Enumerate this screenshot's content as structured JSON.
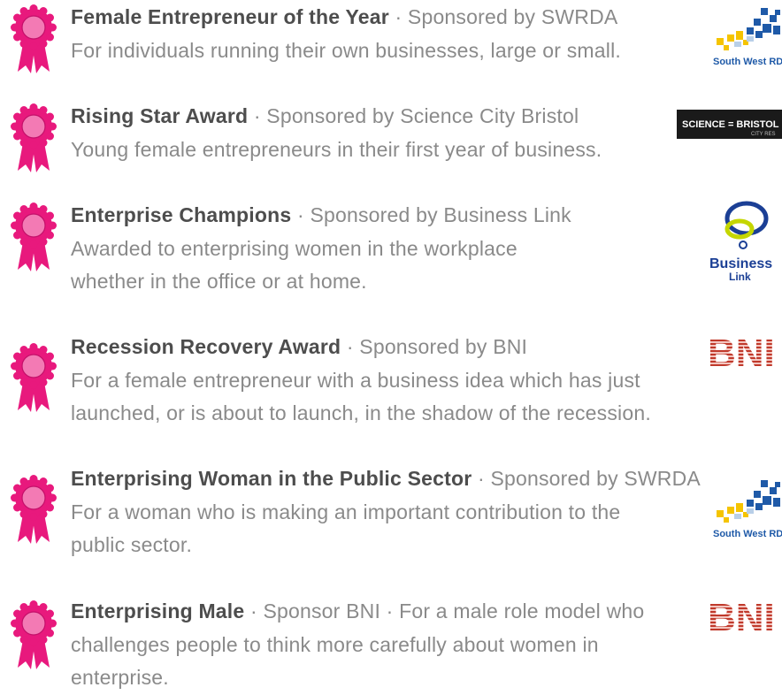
{
  "awards": [
    {
      "title": "Female Entrepreneur of the Year",
      "sponsor": "Sponsored by SWRDA",
      "desc": [
        "For individuals running their own businesses, large or small."
      ],
      "logo": "swrda",
      "logo_text": "South West RDA"
    },
    {
      "title": "Rising Star Award",
      "sponsor": "Sponsored by Science City Bristol",
      "desc": [
        "Young female entrepreneurs in their first year of business."
      ],
      "logo": "science-city",
      "logo_text": "SCIENCE = BRISTOL",
      "logo_subtext": "CITY RES"
    },
    {
      "title": "Enterprise Champions",
      "sponsor": "Sponsored by Business Link",
      "desc": [
        "Awarded to enterprising women in the workplace",
        "whether in the office or at home."
      ],
      "logo": "business-link",
      "logo_text": "Business",
      "logo_subtext": "Link"
    },
    {
      "title": "Recession Recovery Award",
      "sponsor": "Sponsored by BNI",
      "desc": [
        "For a female entrepreneur with a business idea which has just",
        "launched, or is about to launch, in the shadow of the recession."
      ],
      "logo": "bni",
      "logo_text": "BNI"
    },
    {
      "title": "Enterprising Woman in the Public Sector",
      "sponsor": "Sponsored by SWRDA",
      "desc": [
        "For a woman who is making an important contribution to the",
        "public sector."
      ],
      "logo": "swrda",
      "logo_text": "South West RDA"
    },
    {
      "title": "Enterprising Male",
      "sponsor": "Sponsor BNI · For a male role model who",
      "desc": [
        "challenges people to think more carefully about women in",
        "enterprise."
      ],
      "logo": "bni",
      "logo_text": "BNI"
    }
  ],
  "separator": " · ",
  "colors": {
    "rosette": "#e8197d",
    "rosette_center": "#f37ab4",
    "title": "#4d4d4d",
    "body": "#8a8a8a",
    "swrda_blue": "#1f5aa8",
    "swrda_yellow": "#f5c400",
    "business_link_blue": "#1b3f95",
    "business_link_green": "#c4d600",
    "bni_red": "#c0392b"
  }
}
